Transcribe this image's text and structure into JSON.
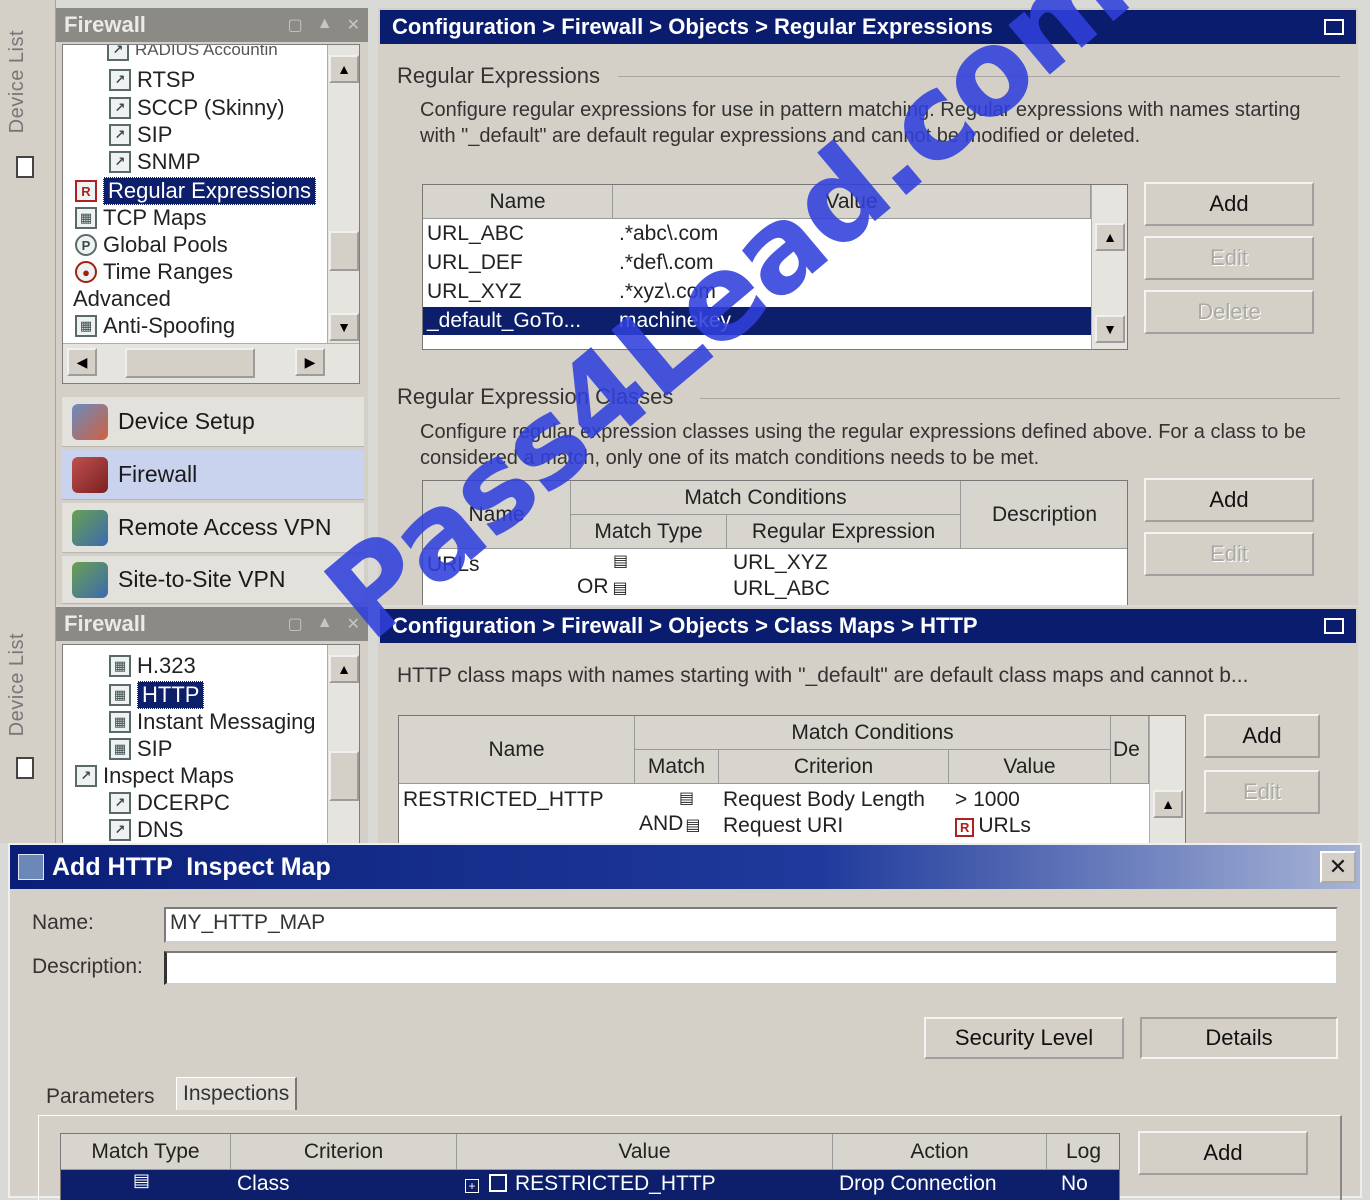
{
  "top_pane": {
    "device_list_label": "Device List",
    "sidebar_title": "Firewall",
    "tree_items": [
      {
        "label": "RADIUS Accountin",
        "icon": "map-icon"
      },
      {
        "label": "RTSP",
        "icon": "map-icon"
      },
      {
        "label": "SCCP (Skinny)",
        "icon": "map-icon"
      },
      {
        "label": "SIP",
        "icon": "map-icon"
      },
      {
        "label": "SNMP",
        "icon": "map-icon"
      },
      {
        "label": "Regular Expressions",
        "icon": "regex-icon"
      },
      {
        "label": "TCP Maps",
        "icon": "tcp-map-icon"
      },
      {
        "label": "Global Pools",
        "icon": "global-pool-icon"
      },
      {
        "label": "Time Ranges",
        "icon": "clock-icon"
      },
      {
        "label": "Advanced",
        "icon": ""
      },
      {
        "label": "Anti-Spoofing",
        "icon": "anti-spoofing-icon"
      }
    ],
    "nav_buttons": [
      {
        "label": "Device Setup",
        "icon": "device-setup-icon"
      },
      {
        "label": "Firewall",
        "icon": "firewall-icon"
      },
      {
        "label": "Remote Access VPN",
        "icon": "remote-vpn-icon"
      },
      {
        "label": "Site-to-Site VPN",
        "icon": "site-vpn-icon"
      }
    ],
    "breadcrumb": "Configuration > Firewall > Objects > Regular Expressions",
    "regex_section": {
      "title": "Regular Expressions",
      "description": "Configure regular expressions for use in pattern matching. Regular expressions with names starting with \"_default\" are default regular expressions and cannot be modified or deleted.",
      "columns": [
        "Name",
        "Value"
      ],
      "rows": [
        {
          "name": "URL_ABC",
          "value": ".*abc\\.com"
        },
        {
          "name": "URL_DEF",
          "value": ".*def\\.com"
        },
        {
          "name": "URL_XYZ",
          "value": ".*xyz\\.com"
        },
        {
          "name": "_default_GoTo...",
          "value": "machinekey"
        }
      ],
      "buttons": {
        "add": "Add",
        "edit": "Edit",
        "delete": "Delete"
      }
    },
    "class_section": {
      "title": "Regular Expression Classes",
      "description": "Configure regular expression classes using the regular expressions defined above. For a class to be considered a match, only one of its match conditions needs to be met.",
      "col_name": "Name",
      "col_match_conditions": "Match Conditions",
      "col_match_type": "Match Type",
      "col_regex": "Regular Expression",
      "col_description": "Description",
      "rows": [
        {
          "name": "URLs",
          "match_type_1": "",
          "regex_1": "URL_XYZ",
          "match_type_2": "OR",
          "regex_2": "URL_ABC"
        }
      ],
      "buttons": {
        "add": "Add",
        "edit": "Edit"
      }
    }
  },
  "bottom_pane": {
    "device_list_label": "Device List",
    "sidebar_title": "Firewall",
    "tree_items": [
      {
        "label": "H.323",
        "icon": "map-icon"
      },
      {
        "label": "HTTP",
        "icon": "map-icon"
      },
      {
        "label": "Instant Messaging",
        "icon": "map-icon"
      },
      {
        "label": "SIP",
        "icon": "map-icon"
      },
      {
        "label": "Inspect Maps",
        "icon": "inspect-map-icon"
      },
      {
        "label": "DCERPC",
        "icon": "map-icon"
      },
      {
        "label": "DNS",
        "icon": "map-icon"
      }
    ],
    "breadcrumb": "Configuration > Firewall > Objects > Class Maps > HTTP",
    "description": "HTTP class maps with names starting with \"_default\" are default class maps and cannot b...",
    "col_name": "Name",
    "col_match_conditions": "Match Conditions",
    "col_match": "Match",
    "col_criterion": "Criterion",
    "col_value": "Value",
    "col_de": "De",
    "rows": [
      {
        "name": "RESTRICTED_HTTP",
        "match_1": "",
        "criterion_1": "Request Body Length",
        "value_1": "> 1000",
        "match_2": "AND",
        "criterion_2": "Request URI",
        "value_2": "URLs"
      }
    ],
    "buttons": {
      "add": "Add",
      "edit": "Edit"
    }
  },
  "dialog": {
    "title": "Add HTTP  Inspect Map",
    "name_label": "Name:",
    "name_value": "MY_HTTP_MAP",
    "description_label": "Description:",
    "description_value": "",
    "security_level_button": "Security Level",
    "details_button": "Details",
    "tabs": [
      "Parameters",
      "Inspections"
    ],
    "columns": [
      "Match Type",
      "Criterion",
      "Value",
      "Action",
      "Log"
    ],
    "rows": [
      {
        "match_type": "",
        "criterion": "Class",
        "value": "RESTRICTED_HTTP",
        "action": "Drop Connection",
        "log": "No"
      }
    ],
    "add_button": "Add"
  },
  "watermark": "Pass4Lead.com",
  "colors": {
    "title_bar": "#0a1c6e",
    "selection": "#0d1f6b",
    "watermark": "#3040dc"
  }
}
